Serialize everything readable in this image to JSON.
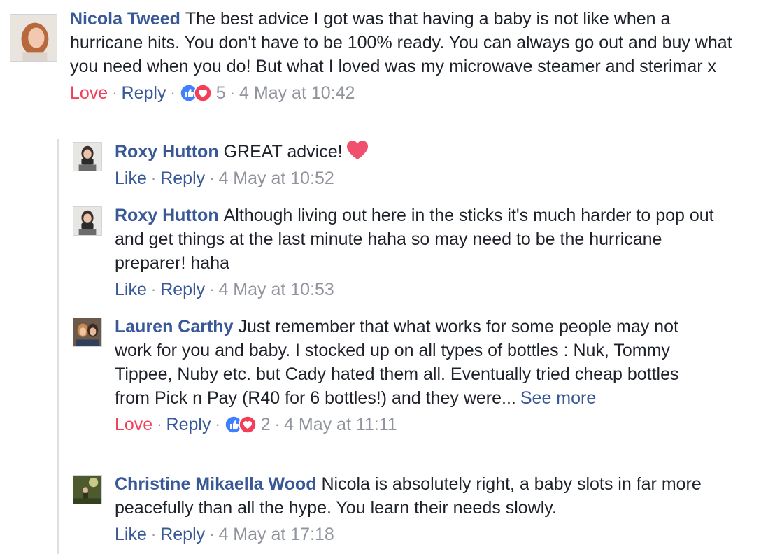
{
  "comments": [
    {
      "author": "Nicola Tweed",
      "text": "The best advice I got was that having a baby is not like when a hurricane hits. You don't have to be 100% ready. You can always go out and buy what you need when you do! But what I loved was my microwave steamer and sterimar x",
      "actions": {
        "reaction_label": "Love",
        "reply_label": "Reply",
        "reaction_count": "5",
        "timestamp": "4 May at 10:42"
      },
      "avatar": "woman-smiling-avatar"
    }
  ],
  "replies": [
    {
      "author": "Roxy Hutton",
      "text": "GREAT advice!",
      "emoji": "heart",
      "actions": {
        "reaction_label": "Like",
        "reply_label": "Reply",
        "timestamp": "4 May at 10:52"
      },
      "avatar": "woman-with-camera-avatar"
    },
    {
      "author": "Roxy Hutton",
      "text": "Although living out here in the sticks it's much harder to pop out and get things at the last minute haha so may need to be the hurricane preparer! haha",
      "actions": {
        "reaction_label": "Like",
        "reply_label": "Reply",
        "timestamp": "4 May at 10:53"
      },
      "avatar": "woman-with-camera-avatar"
    },
    {
      "author": "Lauren Carthy",
      "text": "Just remember that what works for some people may not work for you and baby. I stocked up on all types of bottles : Nuk, Tommy Tippee, Nuby etc. but Cady hated them all. Eventually tried cheap bottles from Pick n Pay (R40 for 6 bottles!) and they were...",
      "see_more": "See more",
      "actions": {
        "reaction_label": "Love",
        "reply_label": "Reply",
        "reaction_count": "2",
        "timestamp": "4 May at 11:11"
      },
      "avatar": "two-women-avatar"
    },
    {
      "author": "Christine Mikaella Wood",
      "text": "Nicola is absolutely right, a baby slots in far more peacefully than all the hype. You learn their needs slowly.",
      "actions": {
        "reaction_label": "Like",
        "reply_label": "Reply",
        "timestamp": "4 May at 17:18"
      },
      "avatar": "outdoor-photo-avatar"
    }
  ],
  "colors": {
    "author": "#385898",
    "meta_gray": "#90949c",
    "love": "#f33e58",
    "like_blue": "#4080ff",
    "thread_line": "#dddfe2"
  }
}
